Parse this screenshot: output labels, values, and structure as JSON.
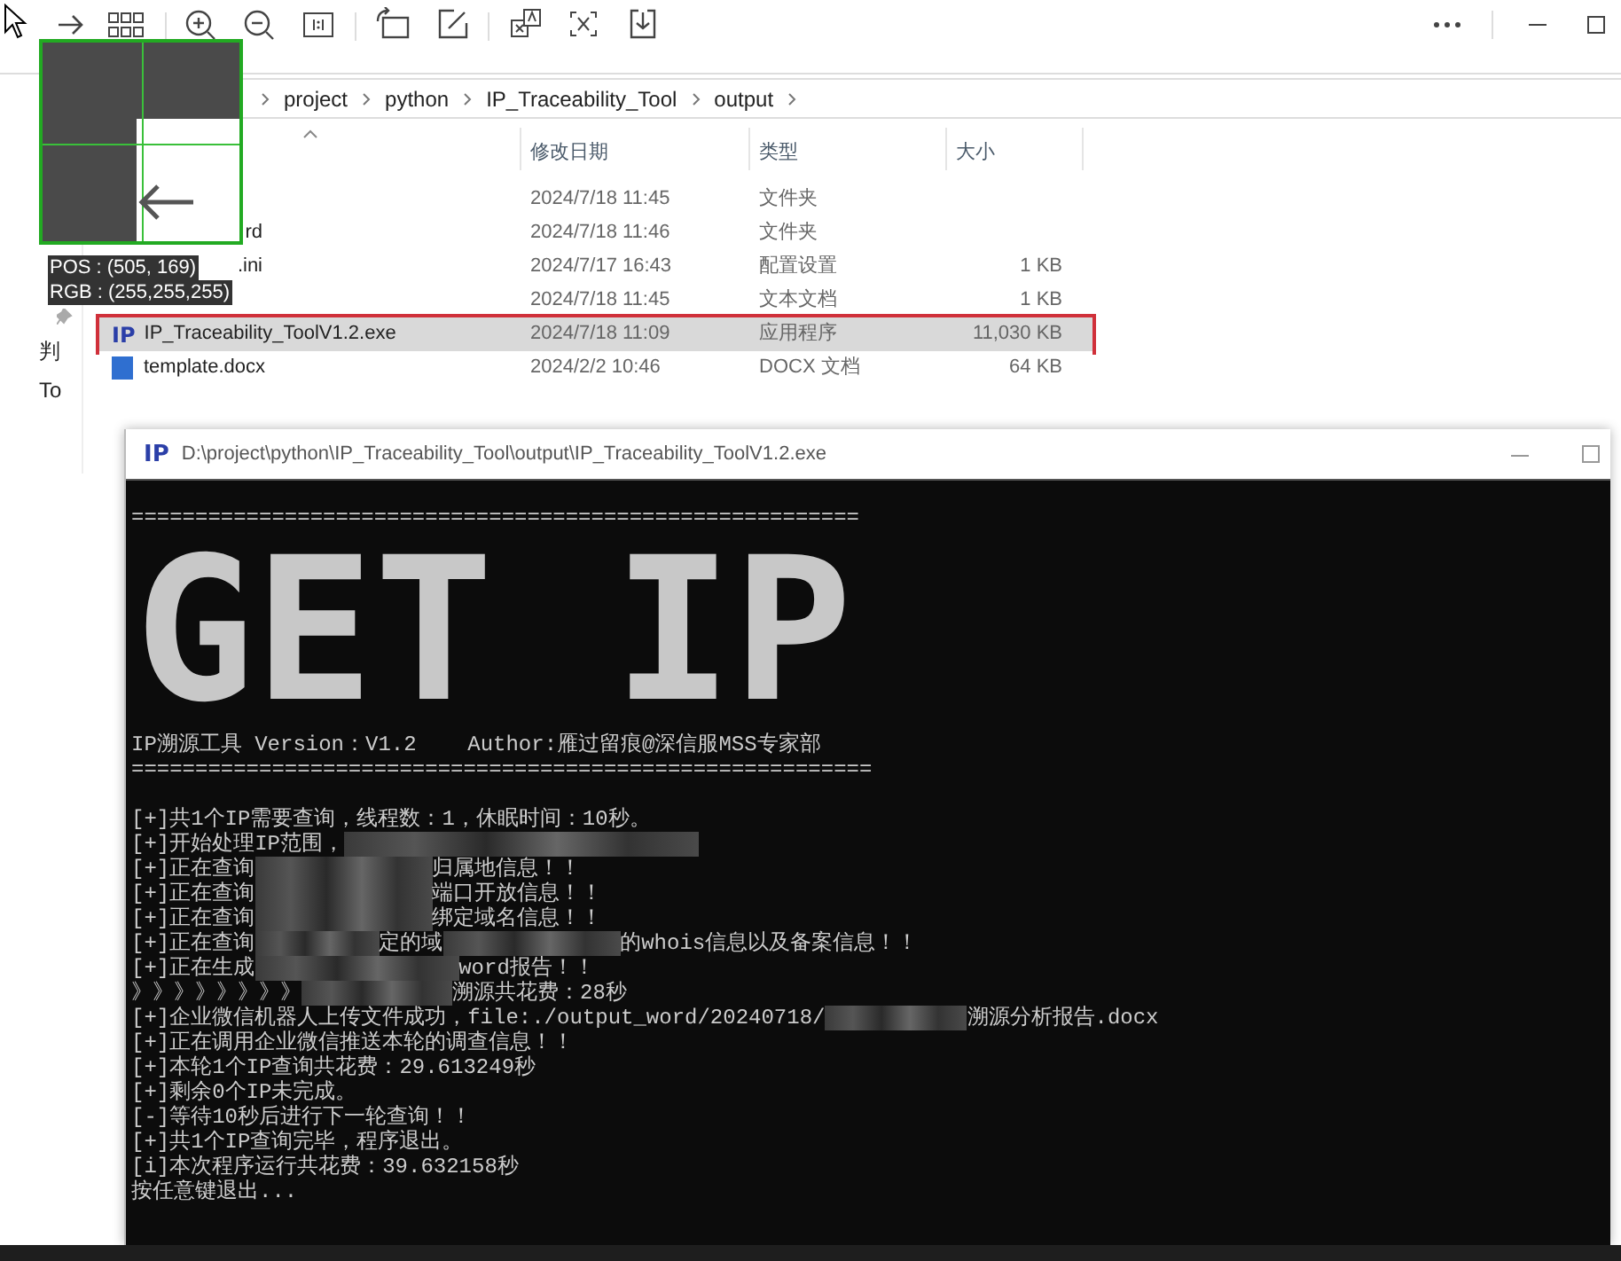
{
  "magnifier": {
    "pos": "POS : (505, 169)",
    "rgb": "RGB : (255,255,255)"
  },
  "explorer": {
    "breadcrumb": [
      "project",
      "python",
      "IP_Traceability_Tool",
      "output"
    ],
    "sidebar": [
      "判",
      "To"
    ],
    "columns": [
      "修改日期",
      "类型",
      "大小"
    ],
    "rows": [
      {
        "kind": "hidden",
        "name": "",
        "date": "2024/7/18 11:45",
        "type": "文件夹",
        "size": "",
        "selected": false,
        "annotated": false
      },
      {
        "kind": "cut",
        "name": "rd",
        "date": "2024/7/18 11:46",
        "type": "文件夹",
        "size": "",
        "selected": false,
        "annotated": false
      },
      {
        "kind": "cut",
        "name": ".ini",
        "date": "2024/7/17 16:43",
        "type": "配置设置",
        "size": "1 KB",
        "selected": false,
        "annotated": false
      },
      {
        "kind": "hidden",
        "name": "",
        "date": "2024/7/18 11:45",
        "type": "文本文档",
        "size": "1 KB",
        "selected": false,
        "annotated": false
      },
      {
        "kind": "exe",
        "icon_text": "IP",
        "name": "IP_Traceability_ToolV1.2.exe",
        "date": "2024/7/18 11:09",
        "type": "应用程序",
        "size": "11,030 KB",
        "selected": true,
        "annotated": true
      },
      {
        "kind": "docx",
        "name": "template.docx",
        "date": "2024/2/2 10:46",
        "type": "DOCX 文档",
        "size": "64 KB",
        "selected": false,
        "annotated": false
      }
    ]
  },
  "console": {
    "icon_text": "IP",
    "title": "D:\\project\\python\\IP_Traceability_Tool\\output\\IP_Traceability_ToolV1.2.exe",
    "rule_top": "=========================================================",
    "banner": "GET IP",
    "info": "IP溯源工具 Version：V1.2    Author:雁过留痕@深信服MSS专家部",
    "rule_bottom": "==========================================================",
    "lines": [
      [
        {
          "kind": "text",
          "text": "[+]共1个IP需要查询，线程数：1，休眠时间：10秒。"
        }
      ],
      [
        {
          "kind": "text",
          "text": "[+]开始处理IP范围，"
        },
        {
          "kind": "redacted"
        }
      ],
      [
        {
          "kind": "text",
          "text": "[+]正在查询"
        },
        {
          "kind": "redacted"
        },
        {
          "kind": "text",
          "text": "归属地信息！！"
        }
      ],
      [
        {
          "kind": "text",
          "text": "[+]正在查询"
        },
        {
          "kind": "redacted"
        },
        {
          "kind": "text",
          "text": "端口开放信息！！"
        }
      ],
      [
        {
          "kind": "text",
          "text": "[+]正在查询"
        },
        {
          "kind": "redacted"
        },
        {
          "kind": "text",
          "text": "绑定域名信息！！"
        }
      ],
      [
        {
          "kind": "text",
          "text": "[+]正在查询"
        },
        {
          "kind": "redacted"
        },
        {
          "kind": "text",
          "text": "定的域"
        },
        {
          "kind": "redacted"
        },
        {
          "kind": "text",
          "text": "的whois信息以及备案信息！！"
        }
      ],
      [
        {
          "kind": "text",
          "text": "[+]正在生成"
        },
        {
          "kind": "redacted"
        },
        {
          "kind": "text",
          "text": "word报告！！"
        }
      ],
      [
        {
          "kind": "text",
          "text": "》》》》》》》》"
        },
        {
          "kind": "redacted"
        },
        {
          "kind": "text",
          "text": "溯源共花费：28秒"
        }
      ],
      [
        {
          "kind": "text",
          "text": "[+]企业微信机器人上传文件成功，file:./output_word/20240718/"
        },
        {
          "kind": "redacted"
        },
        {
          "kind": "text",
          "text": "溯源分析报告.docx"
        }
      ],
      [
        {
          "kind": "text",
          "text": "[+]正在调用企业微信推送本轮的调查信息！！"
        }
      ],
      [
        {
          "kind": "text",
          "text": "[+]本轮1个IP查询共花费：29.613249秒"
        }
      ],
      [
        {
          "kind": "text",
          "text": "[+]剩余0个IP未完成。"
        }
      ],
      [
        {
          "kind": "text",
          "text": "[-]等待10秒后进行下一轮查询！！"
        }
      ],
      [
        {
          "kind": "text",
          "text": "[+]共1个IP查询完毕，程序退出。"
        }
      ],
      [
        {
          "kind": "text",
          "text": "[i]本次程序运行共花费：39.632158秒"
        }
      ],
      [
        {
          "kind": "text",
          "text": "按任意键退出..."
        }
      ]
    ]
  }
}
